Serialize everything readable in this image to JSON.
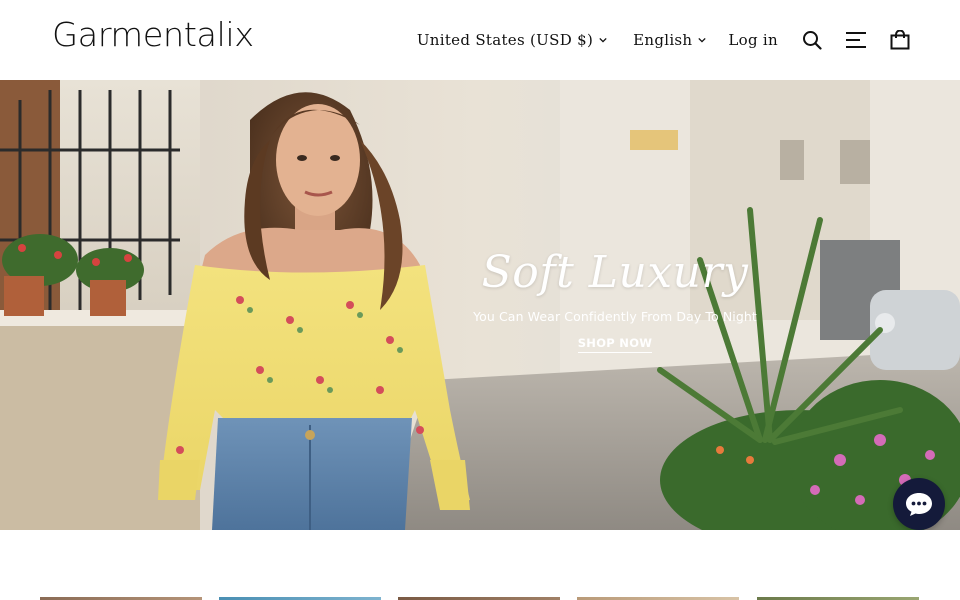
{
  "brand": {
    "logo_text": "Garmentalix"
  },
  "header": {
    "country_selector": "United States (USD $)",
    "language_selector": "English",
    "login_label": "Log in",
    "icons": [
      "search-icon",
      "menu-icon",
      "cart-icon"
    ]
  },
  "hero": {
    "title": "Soft Luxury",
    "subtitle": "You Can Wear Confidently From Day To Night",
    "cta_label": "SHOP NOW"
  },
  "chat": {
    "icon": "chat-bubble-icon",
    "color": "#141a3a"
  },
  "colors": {
    "text": "#111111",
    "hero_text": "#ffffff",
    "chat": "#141a3a"
  }
}
